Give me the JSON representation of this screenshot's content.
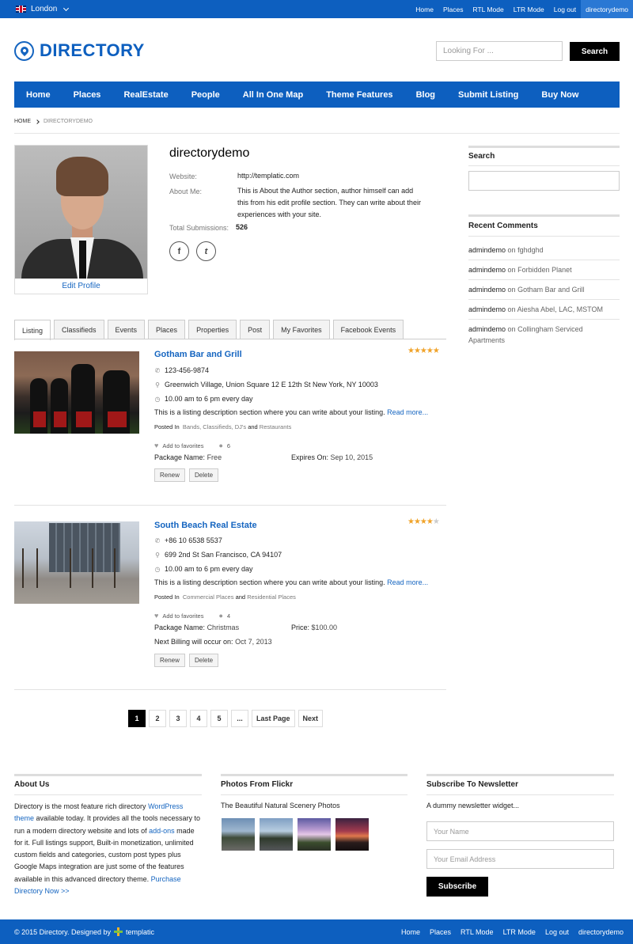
{
  "topbar": {
    "location": "London",
    "nav": [
      "Home",
      "Places",
      "RTL Mode",
      "LTR Mode",
      "Log out",
      "directorydemo"
    ]
  },
  "header": {
    "logo_text": "DIRECTORY",
    "search_placeholder": "Looking For ...",
    "search_button": "Search"
  },
  "mainnav": [
    "Home",
    "Places",
    "RealEstate",
    "People",
    "All In One Map",
    "Theme Features",
    "Blog",
    "Submit Listing",
    "Buy Now"
  ],
  "breadcrumb": {
    "home": "HOME",
    "current": "DIRECTORYDEMO"
  },
  "profile": {
    "name": "directorydemo",
    "edit": "Edit Profile",
    "website_label": "Website:",
    "website": "http://templatic.com",
    "about_label": "About Me:",
    "about": "This is About the Author section, author himself can add this from his edit profile section. They can write about their experiences with your site.",
    "submissions_label": "Total Submissions:",
    "submissions": "526",
    "social": [
      "f",
      "t"
    ]
  },
  "tabs": [
    "Listing",
    "Classifieds",
    "Events",
    "Places",
    "Properties",
    "Post",
    "My Favorites",
    "Facebook Events"
  ],
  "listings": [
    {
      "title": "Gotham Bar and Grill",
      "rating": 5,
      "phone": "123-456-9874",
      "address": "Greenwich Village, Union Square 12 E 12th St New York, NY 10003",
      "hours": "10.00 am to 6 pm every day",
      "desc": "This is a listing description section where you can write about your listing.",
      "read_more": "Read more...",
      "posted_in": "Posted In",
      "tags": "Bands, Classifieds, DJ's",
      "tags_and": "and",
      "tags_last": "Restaurants",
      "fav": "Add to favorites",
      "comments": "6",
      "package_label": "Package Name:",
      "package": "Free",
      "expires_label": "Expires On:",
      "expires": "Sep 10, 2015",
      "renew": "Renew",
      "delete": "Delete"
    },
    {
      "title": "South Beach Real Estate",
      "rating": 4,
      "phone": "+86 10 6538 5537",
      "address": "699 2nd St San Francisco, CA 94107",
      "hours": "10.00 am to 6 pm every day",
      "desc": "This is a listing description section where you can write about your listing.",
      "read_more": "Read more...",
      "posted_in": "Posted In",
      "tags": "Commercial Places",
      "tags_and": "and",
      "tags_last": "Residential Places",
      "fav": "Add to favorites",
      "comments": "4",
      "package_label": "Package Name:",
      "package": "Christmas",
      "price_label": "Price:",
      "price": "$100.00",
      "billing_label": "Next Billing will occur on:",
      "billing": "Oct 7, 2013",
      "renew": "Renew",
      "delete": "Delete"
    }
  ],
  "pagination": [
    "1",
    "2",
    "3",
    "4",
    "5",
    "...",
    "Last Page",
    "Next"
  ],
  "sidebar": {
    "search_title": "Search",
    "comments_title": "Recent Comments",
    "comments": [
      {
        "author": "admindemo",
        "on": "on",
        "target": "fghdghd"
      },
      {
        "author": "admindemo",
        "on": "on",
        "target": "Forbidden Planet"
      },
      {
        "author": "admindemo",
        "on": "on",
        "target": "Gotham Bar and Grill"
      },
      {
        "author": "admindemo",
        "on": "on",
        "target": "Aiesha Abel, LAC, MSTOM"
      },
      {
        "author": "admindemo",
        "on": "on",
        "target": "Collingham Serviced Apartments"
      }
    ]
  },
  "footer_widgets": {
    "about_title": "About Us",
    "about_p1": "Directory is the most feature rich directory",
    "about_link1": "WordPress theme",
    "about_p2": "available today. It provides all the tools necessary to run a modern directory website and lots of",
    "about_link2": "add-ons",
    "about_p3": "made for it. Full listings support, Built-in monetization, unlimited custom fields and categories, custom post types plus Google Maps integration are just some of the features available in this advanced directory theme.",
    "about_link3": "Purchase Directory Now >>",
    "flickr_title": "Photos From Flickr",
    "flickr_sub": "The Beautiful Natural Scenery Photos",
    "newsletter_title": "Subscribe To Newsletter",
    "newsletter_sub": "A dummy newsletter widget...",
    "name_placeholder": "Your Name",
    "email_placeholder": "Your Email Address",
    "subscribe": "Subscribe"
  },
  "footer": {
    "copyright": "© 2015 Directory. Designed by",
    "brand": "templatic",
    "nav": [
      "Home",
      "Places",
      "RTL Mode",
      "LTR Mode",
      "Log out",
      "directorydemo"
    ]
  },
  "colors": {
    "brand": "#0d5fbf",
    "link": "#1565c0",
    "star": "#f0a32a"
  }
}
